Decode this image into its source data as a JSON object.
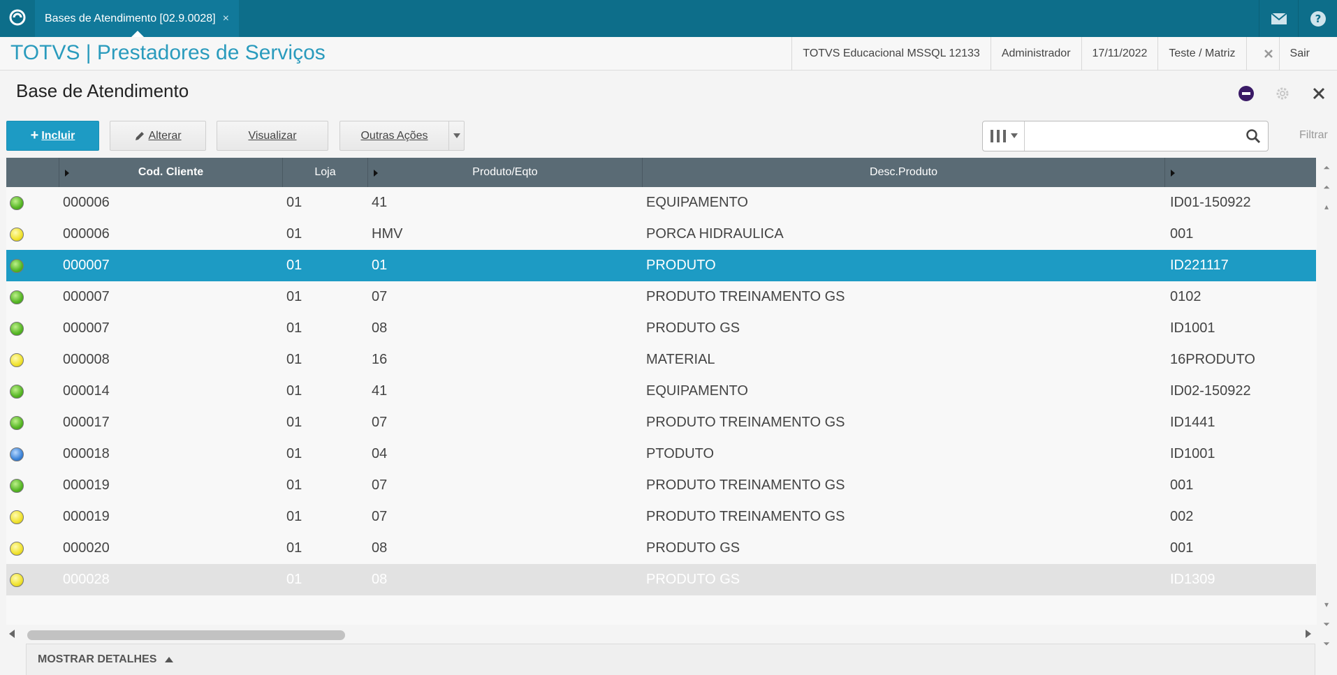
{
  "topbar": {
    "tab_label": "Bases de Atendimento [02.9.0028]",
    "tab_close": "×",
    "icons": [
      "home-icon",
      "mail-icon",
      "help-icon"
    ]
  },
  "header": {
    "brand": "TOTVS | Prestadores de Serviços",
    "environment": "TOTVS Educacional MSSQL 12133",
    "user": "Administrador",
    "date": "17/11/2022",
    "branch": "Teste / Matriz",
    "exit_label": "Sair"
  },
  "page": {
    "title": "Base de Atendimento"
  },
  "actions": {
    "include": "Incluir",
    "alter": "Alterar",
    "view": "Visualizar",
    "other": "Outras Ações",
    "search_placeholder": "",
    "filter": "Filtrar"
  },
  "grid": {
    "columns": [
      "Cod. Cliente",
      "Loja",
      "Produto/Eqto",
      "Desc.Produto"
    ],
    "rows": [
      {
        "status": "green",
        "cliente": "000006",
        "loja": "01",
        "produto": "41",
        "desc": "EQUIPAMENTO",
        "serie": "ID01-150922"
      },
      {
        "status": "yellow",
        "cliente": "000006",
        "loja": "01",
        "produto": "HMV",
        "desc": "PORCA HIDRAULICA",
        "serie": "001"
      },
      {
        "status": "green",
        "cliente": "000007",
        "loja": "01",
        "produto": "01",
        "desc": "PRODUTO",
        "serie": "ID221117",
        "selected": true
      },
      {
        "status": "green",
        "cliente": "000007",
        "loja": "01",
        "produto": "07",
        "desc": "PRODUTO TREINAMENTO GS",
        "serie": "0102"
      },
      {
        "status": "green",
        "cliente": "000007",
        "loja": "01",
        "produto": "08",
        "desc": "PRODUTO GS",
        "serie": "ID1001"
      },
      {
        "status": "yellow",
        "cliente": "000008",
        "loja": "01",
        "produto": "16",
        "desc": "MATERIAL",
        "serie": "16PRODUTO"
      },
      {
        "status": "green",
        "cliente": "000014",
        "loja": "01",
        "produto": "41",
        "desc": "EQUIPAMENTO",
        "serie": "ID02-150922"
      },
      {
        "status": "green",
        "cliente": "000017",
        "loja": "01",
        "produto": "07",
        "desc": "PRODUTO TREINAMENTO GS",
        "serie": "ID1441"
      },
      {
        "status": "blue",
        "cliente": "000018",
        "loja": "01",
        "produto": "04",
        "desc": "PTODUTO",
        "serie": "ID1001"
      },
      {
        "status": "green",
        "cliente": "000019",
        "loja": "01",
        "produto": "07",
        "desc": "PRODUTO TREINAMENTO GS",
        "serie": "001"
      },
      {
        "status": "yellow",
        "cliente": "000019",
        "loja": "01",
        "produto": "07",
        "desc": "PRODUTO TREINAMENTO GS",
        "serie": "002"
      },
      {
        "status": "yellow",
        "cliente": "000020",
        "loja": "01",
        "produto": "08",
        "desc": "PRODUTO GS",
        "serie": "001"
      },
      {
        "status": "yellow",
        "cliente": "000028",
        "loja": "01",
        "produto": "08",
        "desc": "PRODUTO GS",
        "serie": "ID1309",
        "faded": true
      }
    ]
  },
  "footer": {
    "details": "MOSTRAR DETALHES"
  }
}
